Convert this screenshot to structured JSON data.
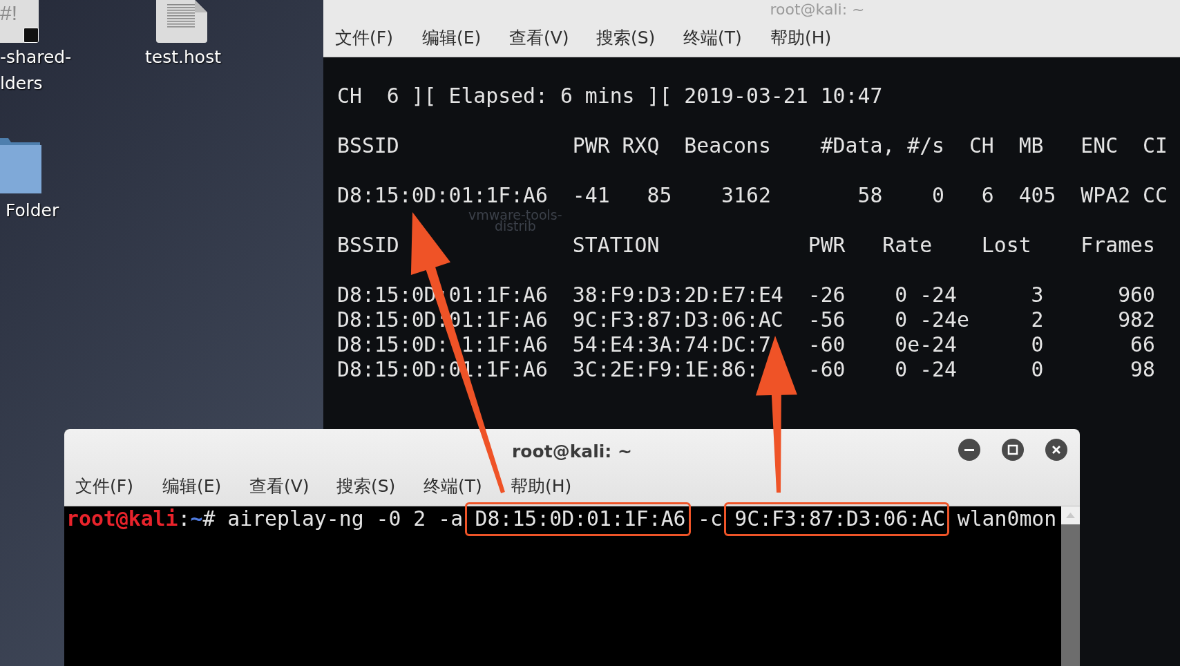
{
  "desktop": {
    "icons": [
      {
        "kind": "script",
        "glyph": "#!",
        "label_lines": [
          "-shared-",
          "lders"
        ]
      },
      {
        "kind": "document",
        "label_lines": [
          "test.host"
        ]
      },
      {
        "kind": "folder",
        "label_lines": [
          "Folder"
        ]
      }
    ]
  },
  "back_window": {
    "title": "root@kali: ~",
    "menu": [
      "文件(F)",
      "编辑(E)",
      "查看(V)",
      "搜索(S)",
      "终端(T)",
      "帮助(H)"
    ],
    "ghost_label": [
      "vmware-tools-",
      "distrib"
    ],
    "blocks": [
      [
        "CH  6 ][ Elapsed: 6 mins ][ 2019-03-21 10:47"
      ],
      [
        "BSSID              PWR RXQ  Beacons    #Data, #/s  CH  MB   ENC  CI"
      ],
      [
        "D8:15:0D:01:1F:A6  -41   85    3162       58    0   6  405  WPA2 CC"
      ],
      [
        "BSSID              STATION            PWR   Rate    Lost    Frames"
      ],
      [
        "D8:15:0D:01:1F:A6  38:F9:D3:2D:E7:E4  -26    0 -24      3      960",
        "D8:15:0D:01:1F:A6  9C:F3:87:D3:06:AC  -56    0 -24e     2      982",
        "D8:15:0D: 1:1F:A6  54:E4:3A:74:DC:7   -60    0e-24      0       66",
        "D8:15:0D:01:1F:A6  3C:2E:F9:1E:86:    -60    0 -24      0       98"
      ]
    ]
  },
  "front_window": {
    "title": "root@kali: ~",
    "controls": [
      {
        "kind": "minimize"
      },
      {
        "kind": "maximize"
      },
      {
        "kind": "close"
      }
    ],
    "menu": [
      "文件(F)",
      "编辑(E)",
      "查看(V)",
      "搜索(S)",
      "终端(T)",
      "帮助(H)"
    ],
    "prompt": {
      "user": "root@kali",
      "separator": ":",
      "path": "~",
      "symbol": "#"
    },
    "command": [
      {
        "text": " aireplay-ng -0 2 -a ",
        "highlighted": false
      },
      {
        "text": "D8:15:0D:01:1F:A6",
        "highlighted": true
      },
      {
        "text": " -c ",
        "highlighted": false
      },
      {
        "text": "9C:F3:87:D3:06:AC",
        "highlighted": true
      },
      {
        "text": " wlan0mon",
        "highlighted": false
      }
    ]
  }
}
